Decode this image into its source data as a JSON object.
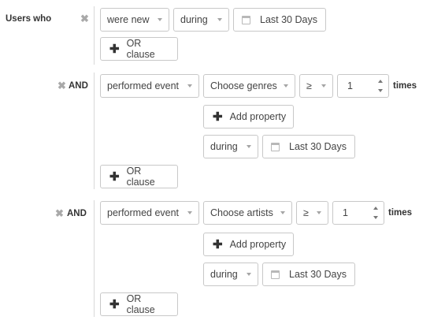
{
  "header": {
    "users_who": "Users who"
  },
  "condition1": {
    "subject": "were new",
    "operator": "during",
    "date_range": "Last 30 Days",
    "or_clause": "OR clause"
  },
  "condition2": {
    "joiner": "AND",
    "action": "performed event",
    "event": "Choose genres",
    "comparator": "≥",
    "count": "1",
    "times": "times",
    "add_property": "Add property",
    "operator": "during",
    "date_range": "Last 30 Days",
    "or_clause": "OR clause"
  },
  "condition3": {
    "joiner": "AND",
    "action": "performed event",
    "event": "Choose artists",
    "comparator": "≥",
    "count": "1",
    "times": "times",
    "add_property": "Add property",
    "operator": "during",
    "date_range": "Last 30 Days",
    "or_clause": "OR clause"
  },
  "icons": {
    "remove": "close-icon",
    "add": "plus-icon",
    "calendar": "calendar-icon",
    "dropdown": "chevron-down-icon",
    "stepper": "stepper-icon"
  }
}
